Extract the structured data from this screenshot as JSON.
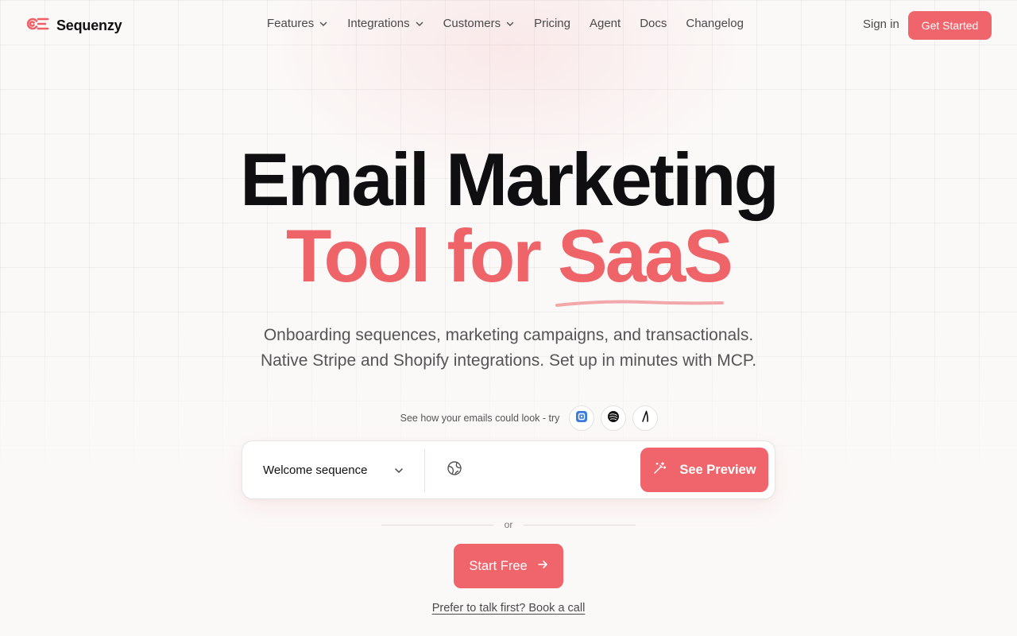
{
  "brand": {
    "name": "Sequenzy",
    "logo_icon": "sequenzy-logo-icon"
  },
  "nav": {
    "items": [
      {
        "label": "Features",
        "has_dropdown": true
      },
      {
        "label": "Integrations",
        "has_dropdown": true
      },
      {
        "label": "Customers",
        "has_dropdown": true
      },
      {
        "label": "Pricing",
        "has_dropdown": false
      },
      {
        "label": "Agent",
        "has_dropdown": false
      },
      {
        "label": "Docs",
        "has_dropdown": false
      },
      {
        "label": "Changelog",
        "has_dropdown": false
      }
    ],
    "sign_in": "Sign in",
    "get_started": "Get Started"
  },
  "hero": {
    "title_line1": "Email Marketing",
    "title_line2_prefix": "Tool for ",
    "title_line2_accent": "SaaS",
    "subtitle_line1": "Onboarding sequences, marketing campaigns, and transactionals.",
    "subtitle_line2": "Native Stripe and Shopify integrations. Set up in minutes with MCP."
  },
  "try": {
    "text": "See how your emails could look - try",
    "examples": [
      "example-brand-1-icon",
      "example-brand-2-icon",
      "example-brand-3-icon"
    ]
  },
  "preview_form": {
    "sequence_value": "Welcome sequence",
    "url_value": "",
    "url_placeholder": "",
    "submit_label": "See Preview"
  },
  "or_text": "or",
  "cta": {
    "start_free": "Start Free"
  },
  "book_call": "Prefer to talk first? Book a call",
  "colors": {
    "accent": "#f0656b",
    "text": "#0f0f12",
    "muted": "#555555",
    "background": "#fbf9f8"
  }
}
